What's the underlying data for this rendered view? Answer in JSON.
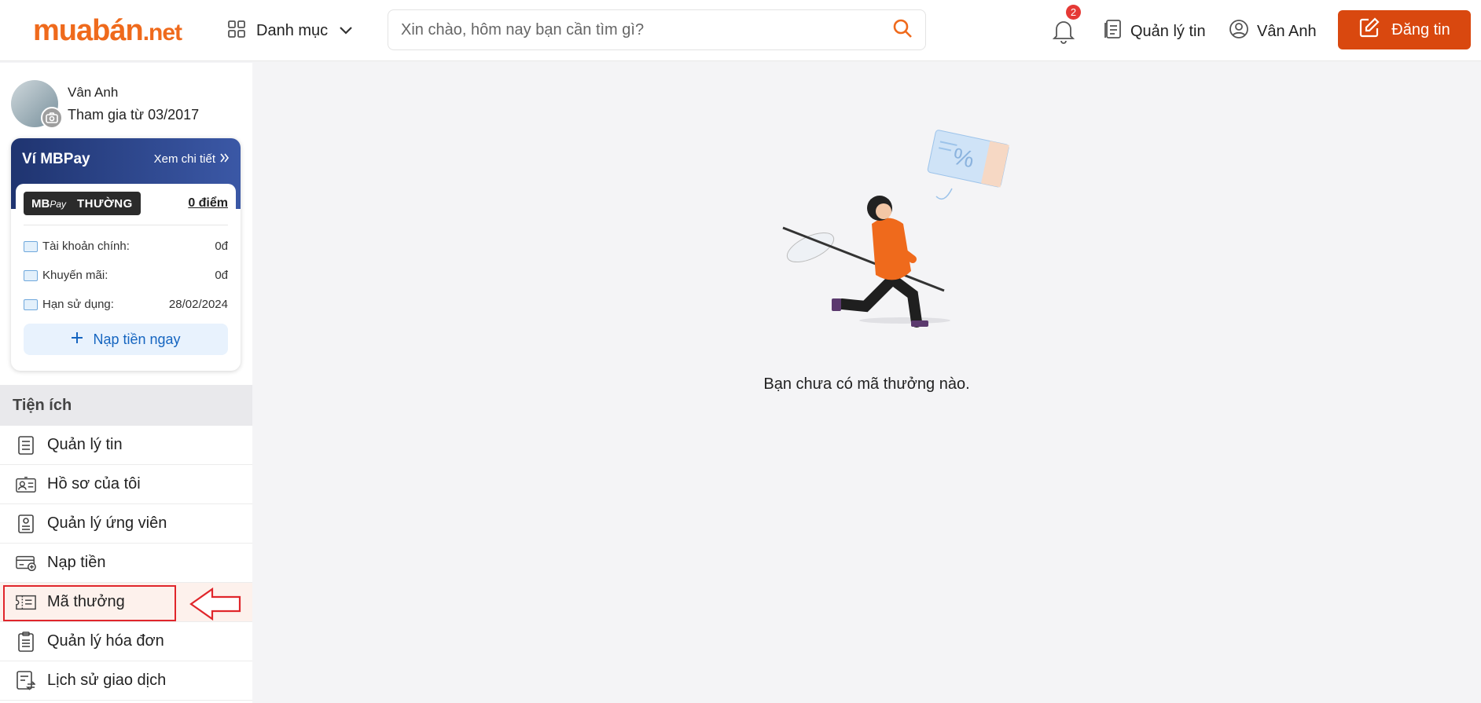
{
  "header": {
    "logo_main": "muabán",
    "logo_tld": ".net",
    "category_label": "Danh mục",
    "search_placeholder": "Xin chào, hôm nay bạn cần tìm gì?",
    "notification_count": "2",
    "manage_posts_label": "Quản lý tin",
    "user_label": "Vân Anh",
    "post_button_label": "Đăng tin"
  },
  "profile": {
    "name": "Vân Anh",
    "joined": "Tham gia từ 03/2017"
  },
  "wallet": {
    "title": "Ví MBPay",
    "detail_link": "Xem chi tiết",
    "tier_brand": "MB",
    "tier_brand_suffix": "Pay",
    "tier_name": "THƯỜNG",
    "points": "0 điểm",
    "rows": [
      {
        "label": "Tài khoản chính:",
        "value": "0đ"
      },
      {
        "label": "Khuyến mãi:",
        "value": "0đ"
      },
      {
        "label": "Hạn sử dụng:",
        "value": "28/02/2024"
      }
    ],
    "topup_label": "Nạp tiền ngay"
  },
  "sidebar": {
    "section_title": "Tiện ích",
    "items": [
      {
        "label": "Quản lý tin",
        "icon": "list-icon"
      },
      {
        "label": "Hồ sơ của tôi",
        "icon": "id-card-icon"
      },
      {
        "label": "Quản lý ứng viên",
        "icon": "candidate-icon"
      },
      {
        "label": "Nạp tiền",
        "icon": "card-icon"
      },
      {
        "label": "Mã thưởng",
        "icon": "voucher-icon"
      },
      {
        "label": "Quản lý hóa đơn",
        "icon": "clipboard-icon"
      },
      {
        "label": "Lịch sử giao dịch",
        "icon": "history-icon"
      }
    ],
    "active_index": 4
  },
  "main": {
    "empty_message": "Bạn chưa có mã thưởng nào."
  },
  "colors": {
    "brand_orange": "#ef6a1c",
    "post_button": "#d9480f",
    "wallet_blue": "#1f3470",
    "highlight_red": "#e0262b"
  }
}
